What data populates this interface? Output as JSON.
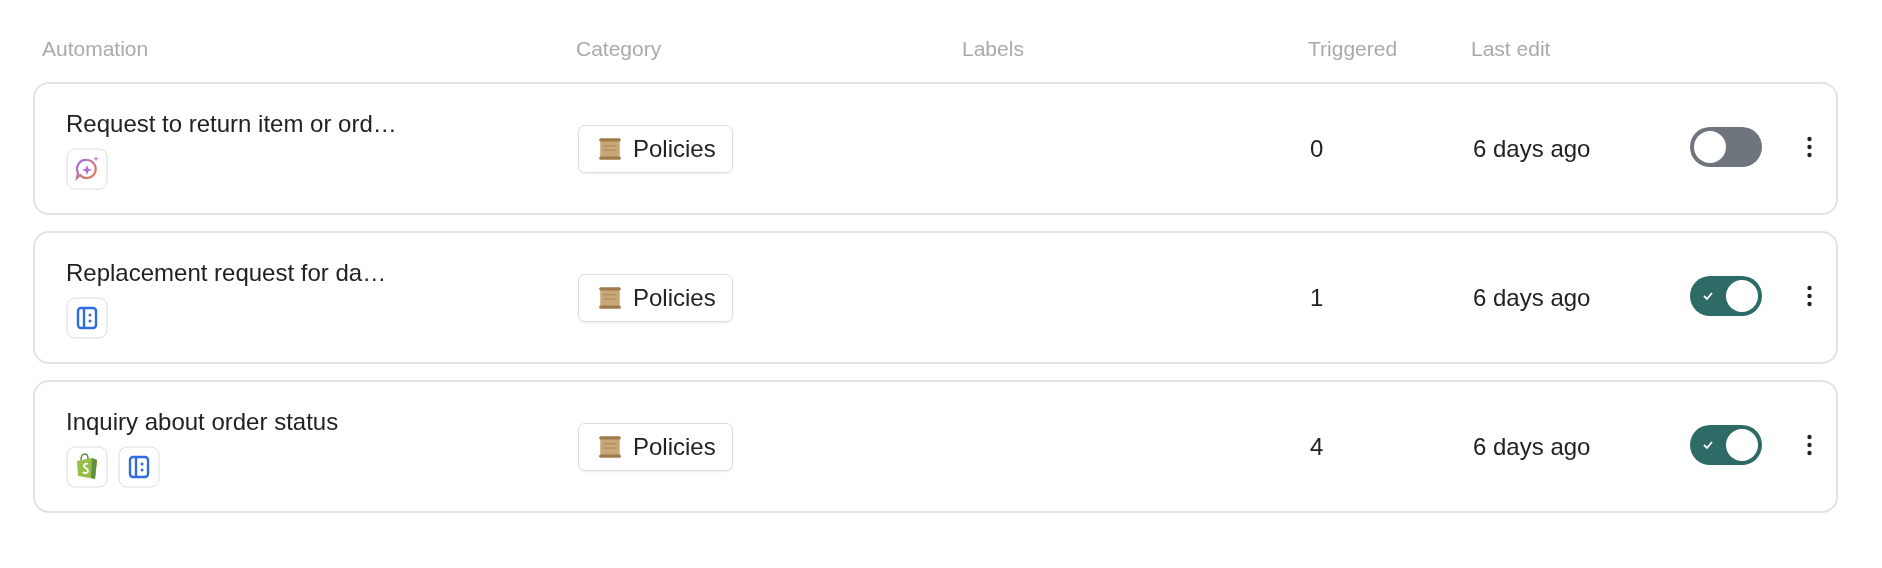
{
  "table": {
    "columns": [
      "Automation",
      "Category",
      "Labels",
      "Triggered",
      "Last edit"
    ],
    "rows": [
      {
        "name": "Request to return item or ord…",
        "integrations": [
          {
            "kind": "ai-chat"
          }
        ],
        "category": "Policies",
        "triggered": "0",
        "last_edit": "6 days ago",
        "on": false
      },
      {
        "name": "Replacement request for da…",
        "integrations": [
          {
            "kind": "form"
          }
        ],
        "category": "Policies",
        "triggered": "1",
        "last_edit": "6 days ago",
        "on": true
      },
      {
        "name": "Inquiry about order status",
        "integrations": [
          {
            "kind": "shop"
          },
          {
            "kind": "form"
          }
        ],
        "category": "Policies",
        "triggered": "4",
        "last_edit": "6 days ago",
        "on": true
      }
    ]
  }
}
